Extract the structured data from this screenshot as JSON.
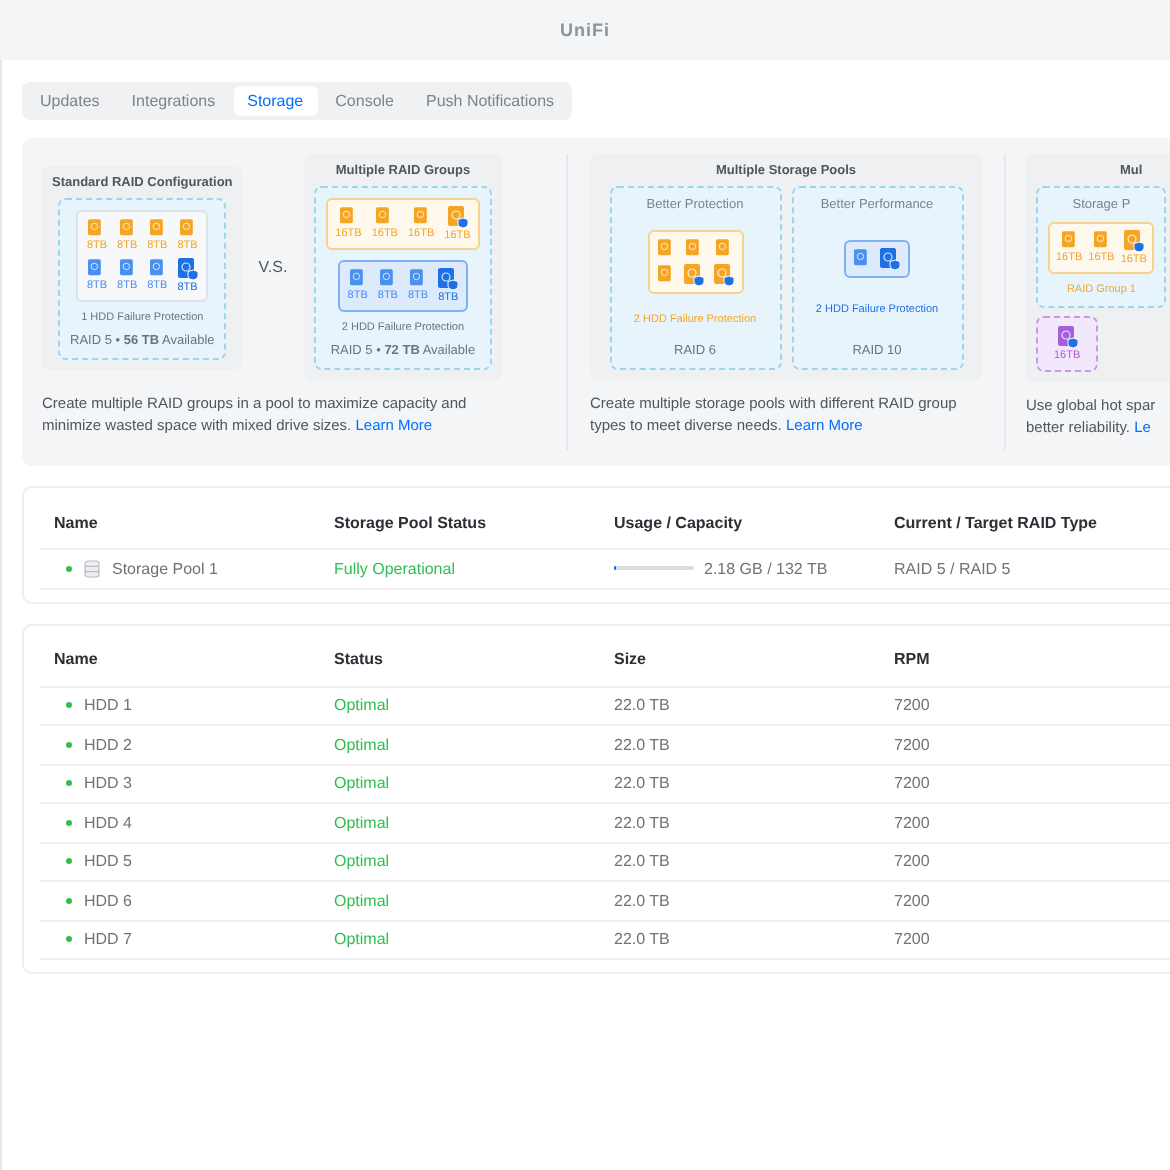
{
  "window": {
    "title": "UniFi"
  },
  "tabs": [
    {
      "label": "Updates",
      "selected": false
    },
    {
      "label": "Integrations",
      "selected": false
    },
    {
      "label": "Storage",
      "selected": true
    },
    {
      "label": "Console",
      "selected": false
    },
    {
      "label": "Push Notifications",
      "selected": false
    }
  ],
  "banner": {
    "sections": [
      {
        "kind": "compare",
        "separator": "V.S.",
        "cards": [
          {
            "title": "Standard RAID Configuration",
            "groups": [
              {
                "color": "#dde3ea",
                "filled": false,
                "drives": [
                  {
                    "label": "8TB",
                    "color": "#f5a524",
                    "spare": false
                  },
                  {
                    "label": "8TB",
                    "color": "#f5a524",
                    "spare": false
                  },
                  {
                    "label": "8TB",
                    "color": "#f5a524",
                    "spare": false
                  },
                  {
                    "label": "8TB",
                    "color": "#f5a524",
                    "spare": false
                  },
                  {
                    "label": "8TB",
                    "color": "#4a90f0",
                    "spare": false
                  },
                  {
                    "label": "8TB",
                    "color": "#4a90f0",
                    "spare": false
                  },
                  {
                    "label": "8TB",
                    "color": "#4a90f0",
                    "spare": false
                  },
                  {
                    "label": "8TB",
                    "color": "#1f6fe5",
                    "spare": true
                  }
                ]
              }
            ],
            "caption": "1 HDD Failure Protection",
            "footer": "RAID 5 • **56 TB** Available"
          },
          {
            "title": "Multiple RAID Groups",
            "groups": [
              {
                "color": "#f7d28a",
                "filled": false,
                "drives": [
                  {
                    "label": "16TB",
                    "color": "#f5a524",
                    "spare": false
                  },
                  {
                    "label": "16TB",
                    "color": "#f5a524",
                    "spare": false
                  },
                  {
                    "label": "16TB",
                    "color": "#f5a524",
                    "spare": false
                  },
                  {
                    "label": "16TB",
                    "color": "#f5a524",
                    "spare": true
                  }
                ]
              },
              {
                "color": "#7fb0f5",
                "filled": true,
                "drives": [
                  {
                    "label": "8TB",
                    "color": "#4a90f0",
                    "spare": false
                  },
                  {
                    "label": "8TB",
                    "color": "#4a90f0",
                    "spare": false
                  },
                  {
                    "label": "8TB",
                    "color": "#4a90f0",
                    "spare": false
                  },
                  {
                    "label": "8TB",
                    "color": "#1f6fe5",
                    "spare": true
                  }
                ]
              }
            ],
            "caption": "2 HDD Failure Protection",
            "footer": "RAID 5 • **72 TB** Available"
          }
        ],
        "description": "Create multiple RAID groups in a pool to maximize capacity and minimize wasted space with mixed drive sizes.",
        "link": "Learn More"
      },
      {
        "kind": "pools",
        "title": "Multiple Storage Pools",
        "panels": [
          {
            "title": "Better Protection",
            "group": {
              "color": "#f7d28a",
              "filled": false,
              "drives": [
                {
                  "color": "#f5a524",
                  "spare": false
                },
                {
                  "color": "#f5a524",
                  "spare": false
                },
                {
                  "color": "#f5a524",
                  "spare": false
                },
                {
                  "color": "#f5a524",
                  "spare": false
                },
                {
                  "color": "#f5a524",
                  "spare": true
                },
                {
                  "color": "#f5a524",
                  "spare": true
                }
              ]
            },
            "caption": "2 HDD Failure Protection",
            "color": "#f5a524",
            "footer": "RAID 6"
          },
          {
            "title": "Better Performance",
            "group": {
              "color": "#7fb0f5",
              "filled": true,
              "drives": [
                {
                  "color": "#4a90f0",
                  "spare": false
                },
                {
                  "color": "#1f6fe5",
                  "spare": true
                }
              ]
            },
            "caption": "2 HDD Failure Protection",
            "color": "#1f6fe5",
            "footer": "RAID 10"
          }
        ],
        "description": "Create multiple storage pools with different RAID group types to meet diverse needs.",
        "link": "Learn More"
      },
      {
        "kind": "spares",
        "title": "Mul",
        "panel_title": "Storage P",
        "group": {
          "color": "#f7d28a",
          "filled": false,
          "drives": [
            {
              "label": "16TB",
              "color": "#f5a524",
              "spare": false
            },
            {
              "label": "16TB",
              "color": "#f5a524",
              "spare": false
            },
            {
              "label": "16TB",
              "color": "#f5a524",
              "spare": true
            }
          ]
        },
        "group_caption": "RAID Group 1",
        "spare": {
          "label": "16TB",
          "color": "#a45ee0",
          "spare": true
        },
        "description": "Use global hot spar",
        "description_2": "better reliability.",
        "link": "Le"
      }
    ]
  },
  "pool_table": {
    "columns": [
      "Name",
      "Storage Pool Status",
      "Usage / Capacity",
      "Current / Target RAID Type"
    ],
    "rows": [
      {
        "name": "Storage Pool 1",
        "color": "#2fbf4f",
        "status": "Fully Operational",
        "level": 0,
        "usage": "2.18 GB / 132 TB",
        "raid": "RAID 5 / RAID 5"
      }
    ]
  },
  "drive_table": {
    "columns": [
      "Name",
      "Status",
      "Size",
      "RPM"
    ],
    "rows": [
      {
        "name": "HDD 1",
        "color": "#2fbf4f",
        "status": "Optimal",
        "size": "22.0 TB",
        "rpm": "7200"
      },
      {
        "name": "HDD 2",
        "color": "#2fbf4f",
        "status": "Optimal",
        "size": "22.0 TB",
        "rpm": "7200"
      },
      {
        "name": "HDD 3",
        "color": "#2fbf4f",
        "status": "Optimal",
        "size": "22.0 TB",
        "rpm": "7200"
      },
      {
        "name": "HDD 4",
        "color": "#2fbf4f",
        "status": "Optimal",
        "size": "22.0 TB",
        "rpm": "7200"
      },
      {
        "name": "HDD 5",
        "color": "#2fbf4f",
        "status": "Optimal",
        "size": "22.0 TB",
        "rpm": "7200"
      },
      {
        "name": "HDD 6",
        "color": "#2fbf4f",
        "status": "Optimal",
        "size": "22.0 TB",
        "rpm": "7200"
      },
      {
        "name": "HDD 7",
        "color": "#2fbf4f",
        "status": "Optimal",
        "size": "22.0 TB",
        "rpm": "7200"
      }
    ]
  }
}
